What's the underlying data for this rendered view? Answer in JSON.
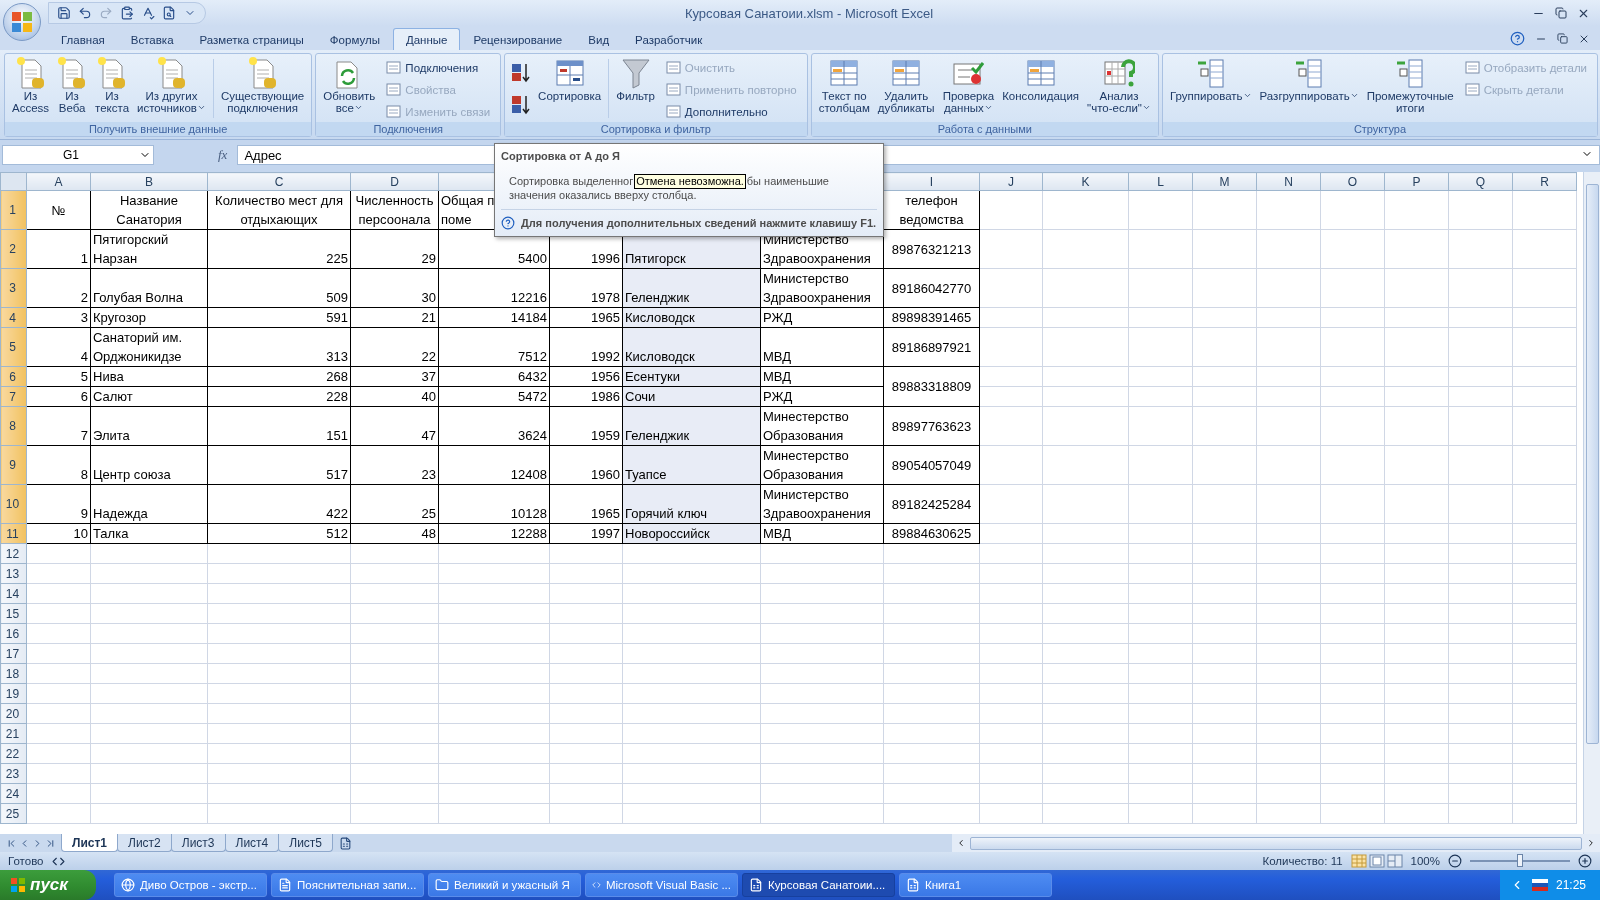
{
  "window": {
    "title": "Курсовая Санатоии.xlsm - Microsoft Excel"
  },
  "tabs": [
    {
      "label": "Главная",
      "selected": false
    },
    {
      "label": "Вставка",
      "selected": false
    },
    {
      "label": "Разметка страницы",
      "selected": false
    },
    {
      "label": "Формулы",
      "selected": false
    },
    {
      "label": "Данные",
      "selected": true
    },
    {
      "label": "Рецензирование",
      "selected": false
    },
    {
      "label": "Вид",
      "selected": false
    },
    {
      "label": "Разработчик",
      "selected": false
    }
  ],
  "ribbon_groups": [
    {
      "title": "Получить внешние данные",
      "items": [
        {
          "kind": "large",
          "lines": [
            "Из",
            "Access"
          ]
        },
        {
          "kind": "large",
          "lines": [
            "Из",
            "Веба"
          ]
        },
        {
          "kind": "large",
          "lines": [
            "Из",
            "текста"
          ]
        },
        {
          "kind": "large",
          "lines": [
            "Из других",
            "источников"
          ],
          "dropdown": true
        },
        {
          "kind": "large",
          "lines": [
            "Существующие",
            "подключения"
          ]
        }
      ]
    },
    {
      "title": "Подключения",
      "items": [
        {
          "kind": "large",
          "lines": [
            "Обновить",
            "все"
          ],
          "dropdown": true
        },
        {
          "kind": "stack",
          "items": [
            {
              "label": "Подключения",
              "disabled": false
            },
            {
              "label": "Свойства",
              "disabled": true
            },
            {
              "label": "Изменить связи",
              "disabled": true
            }
          ]
        }
      ]
    },
    {
      "title": "Сортировка и фильтр",
      "items": [
        {
          "kind": "pair"
        },
        {
          "kind": "large",
          "lines": [
            "Сортировка"
          ]
        },
        {
          "kind": "large",
          "lines": [
            "Фильтр"
          ]
        },
        {
          "kind": "stack",
          "items": [
            {
              "label": "Очистить",
              "disabled": true
            },
            {
              "label": "Применить повторно",
              "disabled": true
            },
            {
              "label": "Дополнительно",
              "disabled": false
            }
          ]
        }
      ]
    },
    {
      "title": "Работа с данными",
      "items": [
        {
          "kind": "large",
          "lines": [
            "Текст по",
            "столбцам"
          ]
        },
        {
          "kind": "large",
          "lines": [
            "Удалить",
            "дубликаты"
          ]
        },
        {
          "kind": "large",
          "lines": [
            "Проверка",
            "данных"
          ],
          "dropdown": true
        },
        {
          "kind": "large",
          "lines": [
            "Консолидация"
          ]
        },
        {
          "kind": "large",
          "lines": [
            "Анализ",
            "\"что-если\""
          ],
          "dropdown": true
        }
      ]
    },
    {
      "title": "Структура",
      "items": [
        {
          "kind": "large",
          "lines": [
            "Группировать"
          ],
          "dropdown": true
        },
        {
          "kind": "large",
          "lines": [
            "Разгруппировать"
          ],
          "dropdown": true
        },
        {
          "kind": "large",
          "lines": [
            "Промежуточные",
            "итоги"
          ]
        },
        {
          "kind": "stack",
          "items": [
            {
              "label": "Отобразить детали",
              "disabled": true
            },
            {
              "label": "Скрыть детали",
              "disabled": true
            }
          ]
        }
      ]
    }
  ],
  "formula_bar": {
    "name_box": "G1",
    "fx": "fx",
    "formula": "Адрес"
  },
  "columns": [
    {
      "label": "A",
      "selected": false
    },
    {
      "label": "B",
      "selected": false
    },
    {
      "label": "C",
      "selected": false
    },
    {
      "label": "D",
      "selected": false
    },
    {
      "selected": false
    },
    {
      "selected": false
    },
    {
      "selected": true
    },
    {
      "selected": false
    },
    {
      "label": "I",
      "selected": false
    },
    {
      "label": "J",
      "selected": false
    },
    {
      "label": "K",
      "selected": false
    },
    {
      "label": "L",
      "selected": false
    },
    {
      "label": "M",
      "selected": false
    },
    {
      "label": "N",
      "selected": false
    },
    {
      "label": "O",
      "selected": false
    },
    {
      "label": "P",
      "selected": false
    },
    {
      "label": "Q",
      "selected": false
    },
    {
      "label": "R",
      "selected": false
    }
  ],
  "rows": [
    {
      "header": "1",
      "selected": true,
      "cells": [
        "№",
        "Название Санатория",
        "Количество мест для отдыхающих",
        "Численность персоонала",
        {
          "lines": [
            "Общая п",
            "поме"
          ],
          "cut": true
        },
        null,
        null,
        null,
        "телефон ведомства"
      ]
    },
    {
      "header": "2",
      "selected": true,
      "cells": [
        "1",
        "Пятигорский Нарзан",
        "225",
        "29",
        "5400",
        "1996",
        "Пятигорск",
        "Министерство Здравоохранения",
        "89876321213"
      ]
    },
    {
      "header": "3",
      "selected": true,
      "cells": [
        "2",
        "Голубая Волна",
        "509",
        "30",
        "12216",
        "1978",
        "Геленджик",
        "Министерство Здравоохранения",
        "89186042770"
      ]
    },
    {
      "header": "4",
      "selected": true,
      "cells": [
        "3",
        "Кругозор",
        "591",
        "21",
        "14184",
        "1965",
        "Кисловодск",
        "РЖД",
        "89898391465"
      ]
    },
    {
      "header": "5",
      "selected": true,
      "cells": [
        "4",
        "Санаторий им. Орджоникидзе",
        "313",
        "22",
        "7512",
        "1992",
        "Кисловодск",
        "МВД",
        "89186897921"
      ]
    },
    {
      "header": "6",
      "selected": true,
      "merge_last_down": true,
      "cells": [
        "5",
        "Нива",
        "268",
        "37",
        "6432",
        "1956",
        "Есентуки",
        "МВД",
        "89883318809"
      ]
    },
    {
      "header": "7",
      "selected": true,
      "cells": [
        "6",
        "Салют",
        "228",
        "40",
        "5472",
        "1986",
        "Сочи",
        "РЖД"
      ]
    },
    {
      "header": "8",
      "selected": true,
      "cells": [
        "7",
        "Элита",
        "151",
        "47",
        "3624",
        "1959",
        "Геленджик",
        "Минестерство Образования",
        "89897763623"
      ]
    },
    {
      "header": "9",
      "selected": true,
      "cells": [
        "8",
        "Центр союза",
        "517",
        "23",
        "12408",
        "1960",
        "Туапсе",
        "Минестерство Образования",
        "89054057049"
      ]
    },
    {
      "header": "10",
      "selected": true,
      "cells": [
        "9",
        "Надежда",
        "422",
        "25",
        "10128",
        "1965",
        "Горячий ключ",
        "Министерство Здравоохранения",
        "89182425284"
      ]
    },
    {
      "header": "11",
      "selected": true,
      "cells": [
        "10",
        "Талка",
        "512",
        "48",
        "12288",
        "1997",
        "Новороссийск",
        "МВД",
        "89884630625"
      ]
    },
    {
      "header": "12",
      "selected": false
    },
    {
      "header": "13",
      "selected": false
    },
    {
      "header": "14",
      "selected": false
    },
    {
      "header": "15",
      "selected": false
    },
    {
      "header": "16",
      "selected": false
    },
    {
      "header": "17",
      "selected": false
    },
    {
      "header": "18",
      "selected": false
    },
    {
      "header": "19",
      "selected": false
    },
    {
      "header": "20",
      "selected": false
    },
    {
      "header": "21",
      "selected": false
    },
    {
      "header": "22",
      "selected": false
    },
    {
      "header": "23",
      "selected": false
    },
    {
      "header": "24",
      "selected": false
    },
    {
      "header": "25",
      "selected": false
    }
  ],
  "tooltip": {
    "title": "Сортировка от А до Я",
    "body_start": "Сортировка выделенног",
    "body_end": "бы наименьшие",
    "body_line2": "значения оказались вверху столбца.",
    "screen_tip": "Отмена невозможна.",
    "help": "Для получения дополнительных сведений нажмите клавишу F1."
  },
  "sheets": [
    {
      "label": "Лист1",
      "selected": true
    },
    {
      "label": "Лист2",
      "selected": false
    },
    {
      "label": "Лист3",
      "selected": false
    },
    {
      "label": "Лист4",
      "selected": false
    },
    {
      "label": "Лист5",
      "selected": false
    }
  ],
  "status_bar": {
    "state": "Готово",
    "count": "Количество: 11",
    "zoom": "100%",
    "zoom_slider": {
      "level": 0.5
    }
  },
  "taskbar": {
    "start": "пуск",
    "items": [
      {
        "label": "Диво Остров - экстр...",
        "selected": false
      },
      {
        "label": "Пояснительная запи...",
        "selected": false
      },
      {
        "label": "Великий и ужасный Я",
        "selected": false
      },
      {
        "label": "Microsoft Visual Basic ...",
        "selected": false
      },
      {
        "label": "Курсовая Санатоии....",
        "selected": true
      },
      {
        "label": "Книга1",
        "selected": false
      }
    ],
    "clock": "21:25"
  }
}
